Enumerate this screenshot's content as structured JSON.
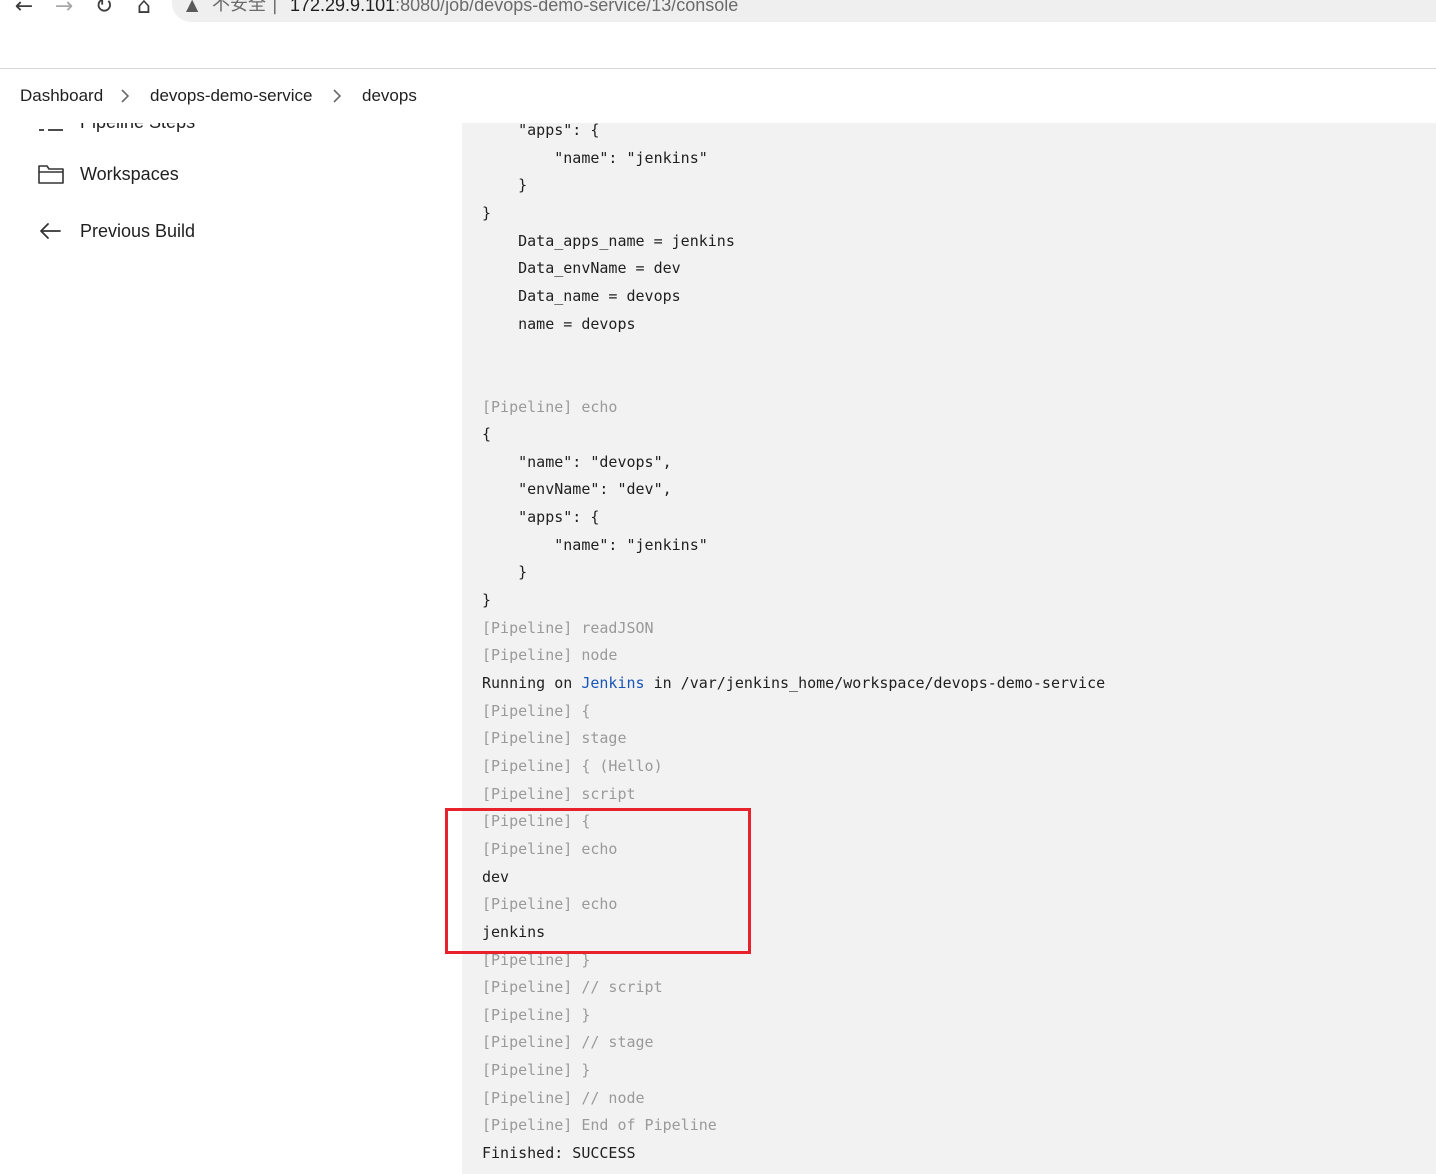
{
  "browser": {
    "security_label": "不安全",
    "separator": "|",
    "url_host": "172.29.9.101",
    "url_path": ":8080/job/devops-demo-service/13/console"
  },
  "breadcrumb": {
    "items": [
      "Dashboard",
      "devops-demo-service",
      "devops"
    ]
  },
  "sidebar": {
    "partial_label": "Pipeline Steps",
    "workspaces_label": "Workspaces",
    "previous_build_label": "Previous Build"
  },
  "console": {
    "lines": [
      {
        "text": "    \"apps\": {",
        "type": "out"
      },
      {
        "text": "        \"name\": \"jenkins\"",
        "type": "out"
      },
      {
        "text": "    }",
        "type": "out"
      },
      {
        "text": "}",
        "type": "out"
      },
      {
        "text": "    Data_apps_name = jenkins",
        "type": "out"
      },
      {
        "text": "    Data_envName = dev",
        "type": "out"
      },
      {
        "text": "    Data_name = devops",
        "type": "out"
      },
      {
        "text": "    name = devops",
        "type": "out"
      },
      {
        "text": "",
        "type": "out"
      },
      {
        "text": "",
        "type": "out"
      },
      {
        "text": "[Pipeline] echo",
        "type": "pl"
      },
      {
        "text": "{",
        "type": "out"
      },
      {
        "text": "    \"name\": \"devops\",",
        "type": "out"
      },
      {
        "text": "    \"envName\": \"dev\",",
        "type": "out"
      },
      {
        "text": "    \"apps\": {",
        "type": "out"
      },
      {
        "text": "        \"name\": \"jenkins\"",
        "type": "out"
      },
      {
        "text": "    }",
        "type": "out"
      },
      {
        "text": "}",
        "type": "out"
      },
      {
        "text": "[Pipeline] readJSON",
        "type": "pl"
      },
      {
        "text": "[Pipeline] node",
        "type": "pl"
      },
      {
        "text": "",
        "type": "running"
      },
      {
        "text": "[Pipeline] {",
        "type": "pl"
      },
      {
        "text": "[Pipeline] stage",
        "type": "pl"
      },
      {
        "text": "[Pipeline] { (Hello)",
        "type": "pl"
      },
      {
        "text": "[Pipeline] script",
        "type": "pl"
      },
      {
        "text": "[Pipeline] {",
        "type": "pl"
      },
      {
        "text": "[Pipeline] echo",
        "type": "pl"
      },
      {
        "text": "dev",
        "type": "out"
      },
      {
        "text": "[Pipeline] echo",
        "type": "pl"
      },
      {
        "text": "jenkins",
        "type": "out"
      },
      {
        "text": "[Pipeline] }",
        "type": "pl"
      },
      {
        "text": "[Pipeline] // script",
        "type": "pl"
      },
      {
        "text": "[Pipeline] }",
        "type": "pl"
      },
      {
        "text": "[Pipeline] // stage",
        "type": "pl"
      },
      {
        "text": "[Pipeline] }",
        "type": "pl"
      },
      {
        "text": "[Pipeline] // node",
        "type": "pl"
      },
      {
        "text": "[Pipeline] End of Pipeline",
        "type": "pl"
      },
      {
        "text": "Finished: SUCCESS",
        "type": "out"
      }
    ],
    "running_line": {
      "prefix": "Running on ",
      "link": "Jenkins",
      "suffix": " in /var/jenkins_home/workspace/devops-demo-service"
    }
  },
  "colors": {
    "console_bg": "#f2f2f2",
    "pipeline_text": "#9a9a9a",
    "link": "#1a56b8",
    "highlight": "#e8222b"
  }
}
